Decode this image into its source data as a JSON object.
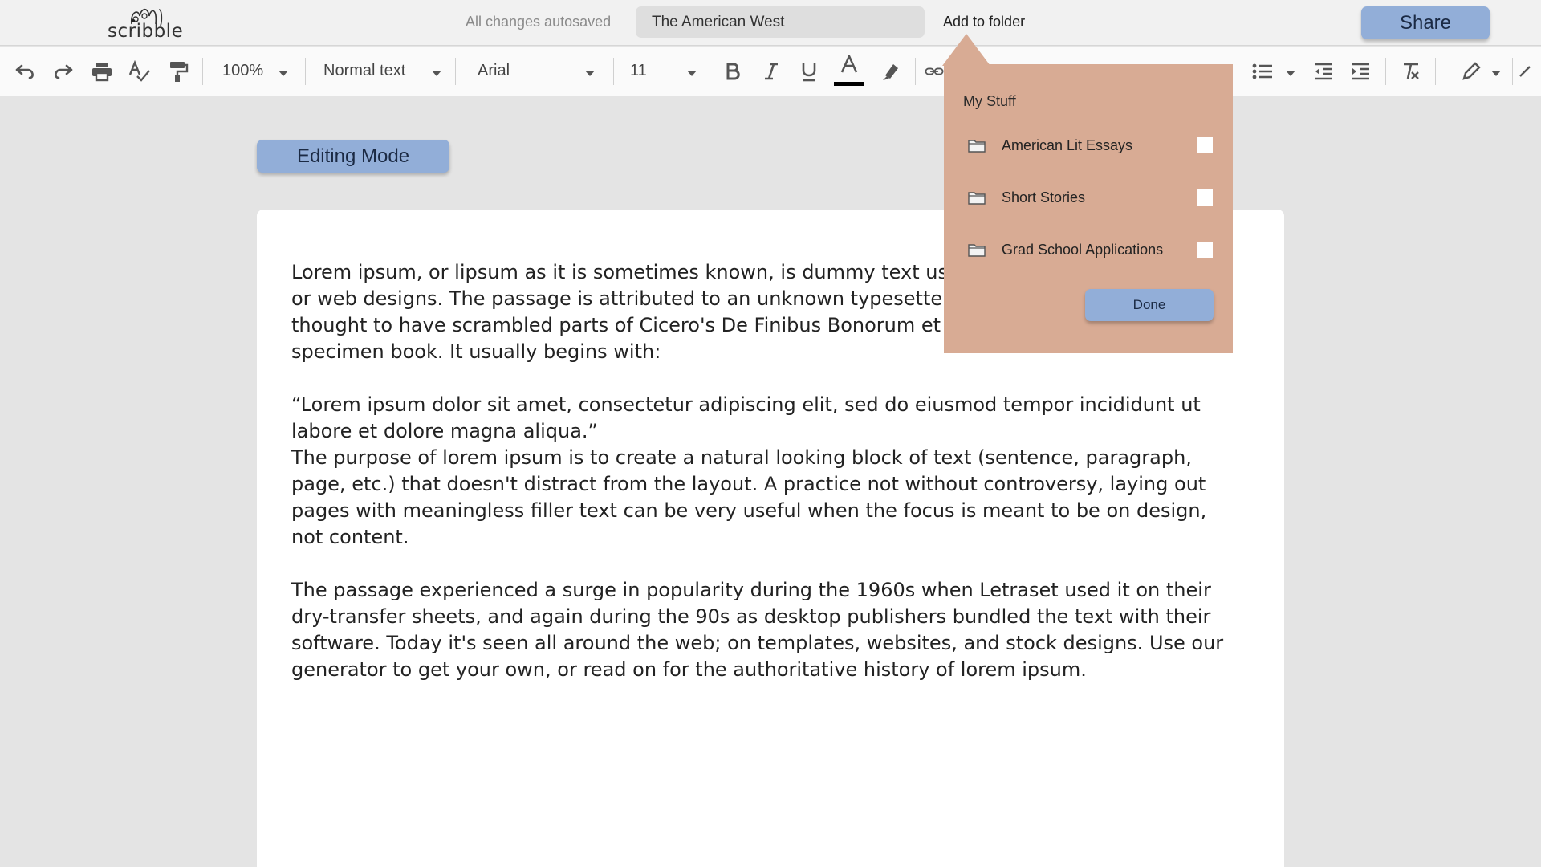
{
  "header": {
    "logo_text": "scribble",
    "autosave_status": "All changes autosaved",
    "document_title": "The American West",
    "add_to_folder_label": "Add to folder",
    "share_label": "Share"
  },
  "toolbar": {
    "zoom": "100%",
    "paragraph_style": "Normal text",
    "font_family": "Arial",
    "font_size": "11",
    "icons": [
      "undo-icon",
      "redo-icon",
      "print-icon",
      "spellcheck-icon",
      "paint-format-icon",
      "bold-icon",
      "italic-icon",
      "underline-icon",
      "text-color-icon",
      "highlight-icon",
      "link-icon",
      "bulleted-list-icon",
      "decrease-indent-icon",
      "increase-indent-icon",
      "clear-formatting-icon",
      "edit-pen-icon"
    ]
  },
  "editing_mode_label": "Editing Mode",
  "document": {
    "paragraphs": [
      "Lorem ipsum, or lipsum as it is sometimes known, is dummy text used in laying out print, graphic or web designs. The passage is attributed to an unknown typesetter in the 15th century who is thought to have scrambled parts of Cicero's De Finibus Bonorum et Malorum for use in a type specimen book. It usually begins with:",
      "“Lorem ipsum dolor sit amet, consectetur adipiscing elit, sed do eiusmod tempor incididunt ut labore et dolore magna aliqua.”",
      "The purpose of lorem ipsum is to create a natural looking block of text (sentence, paragraph, page, etc.) that doesn't distract from the layout. A practice not without controversy, laying out pages with meaningless filler text can be very useful when the focus is meant to be on design, not content.",
      "The passage experienced a surge in popularity during the 1960s when Letraset used it on their dry-transfer sheets, and again during the 90s as desktop publishers bundled the text with their software. Today it's seen all around the web; on templates, websites, and stock designs. Use our generator to get your own, or read on for the authoritative history of lorem ipsum."
    ]
  },
  "folder_popup": {
    "title": "My Stuff",
    "folders": [
      {
        "name": "American Lit Essays",
        "checked": false
      },
      {
        "name": "Short Stories",
        "checked": false
      },
      {
        "name": "Grad School Applications",
        "checked": false
      }
    ],
    "done_label": "Done"
  },
  "colors": {
    "accent_button": "#92aed8",
    "popup_background": "#d8ab94",
    "header_background": "#f1f1f1",
    "canvas_background": "#e4e4e4"
  }
}
